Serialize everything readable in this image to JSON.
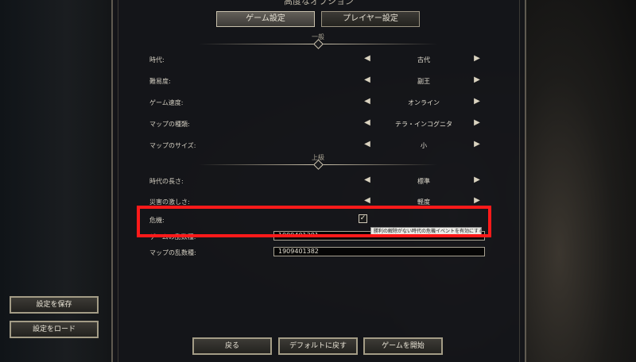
{
  "panel": {
    "title": "高度なオプション"
  },
  "tabs": [
    {
      "label": "ゲーム設定",
      "active": true
    },
    {
      "label": "プレイヤー設定",
      "active": false
    }
  ],
  "sections": {
    "general": "一般",
    "advanced": "上級"
  },
  "rows": [
    {
      "label": "時代:",
      "value": "古代"
    },
    {
      "label": "難易度:",
      "value": "副王"
    },
    {
      "label": "ゲーム速度:",
      "value": "オンライン"
    },
    {
      "label": "マップの種類:",
      "value": "テラ・インコグニタ"
    },
    {
      "label": "マップのサイズ:",
      "value": "小"
    },
    {
      "label": "時代の長さ:",
      "value": "標準"
    },
    {
      "label": "災害の激しさ:",
      "value": "軽度"
    }
  ],
  "crisis": {
    "label": "危機:",
    "checked": true,
    "check_glyph": "✓"
  },
  "seeds": {
    "game_label": "ゲームの乱数種:",
    "game_value": "1909401381",
    "map_label": "マップの乱数種:",
    "map_value": "1909401382"
  },
  "tooltip": {
    "text": "勝利の解除がない時代の危機イベントを有効にする"
  },
  "side_buttons": {
    "save": "設定を保存",
    "load": "設定をロード"
  },
  "bottom_buttons": {
    "back": "戻る",
    "reset": "デフォルトに戻す",
    "start": "ゲームを開始"
  },
  "icons": {
    "prev": "chevron-left-icon",
    "next": "chevron-right-icon"
  },
  "colors": {
    "highlight": "#ff1a1a",
    "accent": "#a39c86"
  }
}
